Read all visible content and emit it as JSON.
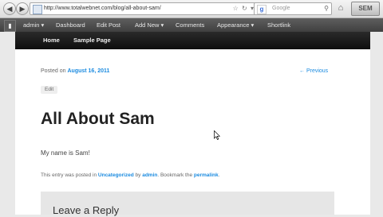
{
  "browser": {
    "url": "http://www.totalwebnet.com/blog/all-about-sam/",
    "search_placeholder": "Google",
    "search_engine_glyph": "g",
    "addon_label": "SEM",
    "back_glyph": "◀",
    "forward_glyph": "▶",
    "url_icons": "☆ ↻ ▾",
    "search_glyph": "⚲",
    "home_glyph": "⌂"
  },
  "admin_bar": {
    "items": [
      "admin ▾",
      "Dashboard",
      "Edit Post",
      "Add New ▾",
      "Comments",
      "Appearance ▾",
      "Shortlink"
    ],
    "logo_glyph": "▮"
  },
  "site_nav": {
    "items": [
      "Home",
      "Sample Page"
    ]
  },
  "post": {
    "posted_on_prefix": "Posted on",
    "date": "August 16, 2011",
    "previous_link": "← Previous",
    "edit_label": "Edit",
    "title": "All About Sam",
    "body": "My name is Sam!",
    "meta": {
      "prefix": "This entry was posted in",
      "category": "Uncategorized",
      "by": "by",
      "author": "admin",
      "bookmark": ". Bookmark the",
      "permalink": "permalink",
      "end": "."
    }
  },
  "reply": {
    "title": "Leave a Reply"
  },
  "colors": {
    "link": "#1b8be0",
    "admin_bar": "#464646",
    "site_nav": "#1a1a1a"
  }
}
